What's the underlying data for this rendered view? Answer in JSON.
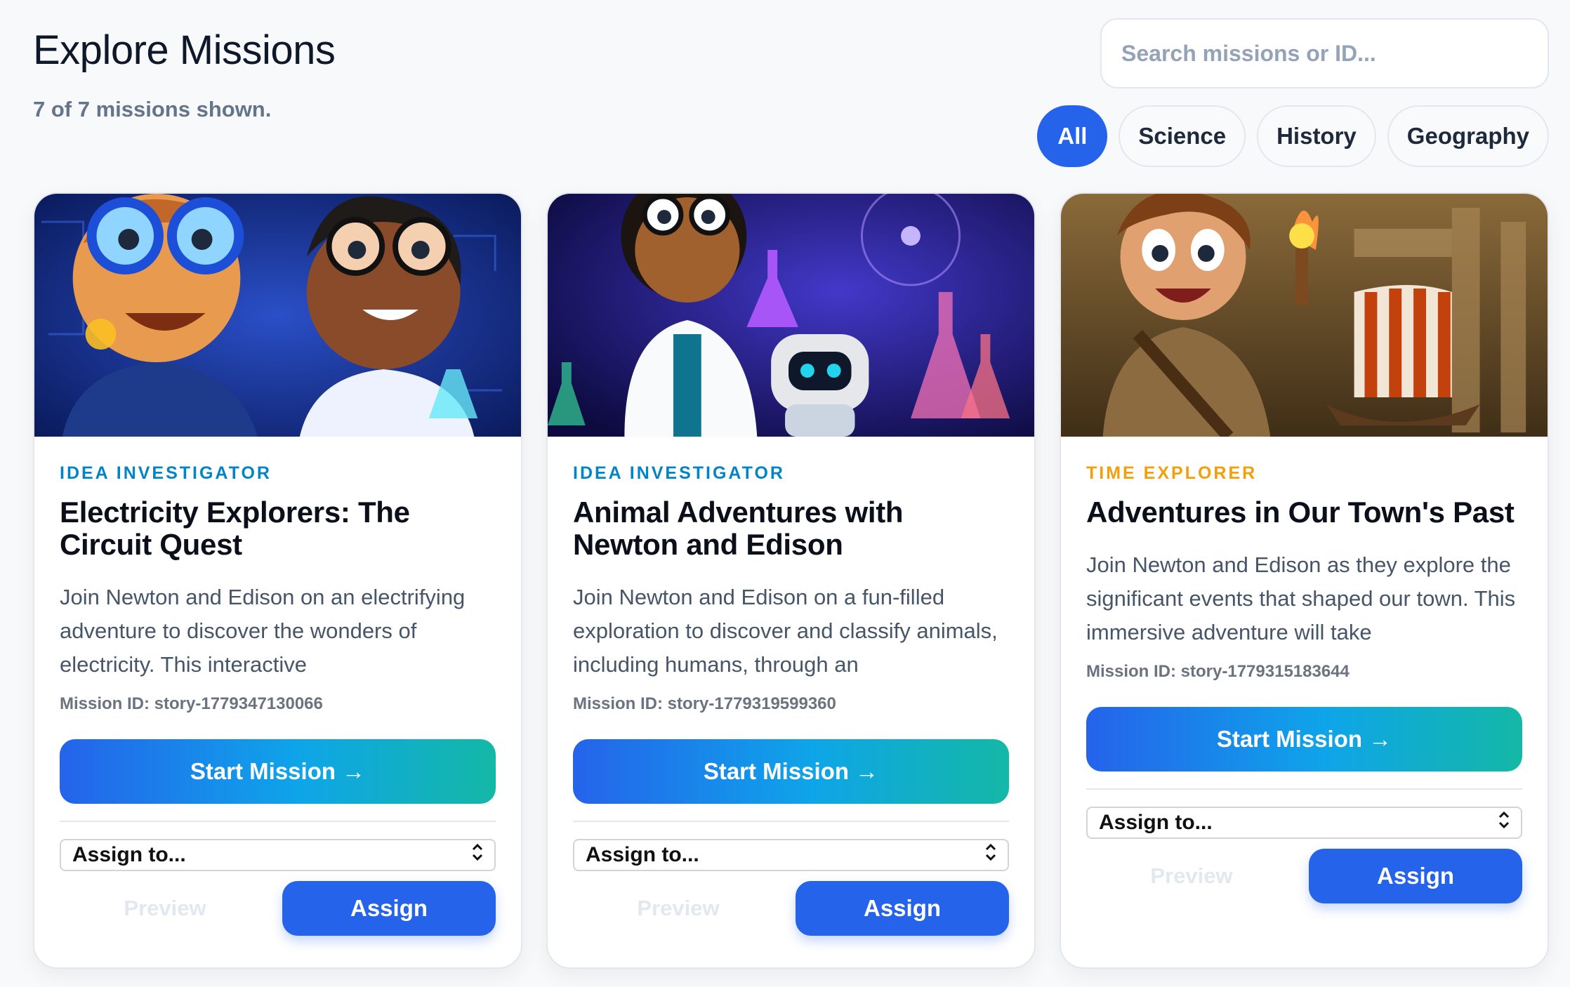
{
  "header": {
    "title": "Explore Missions",
    "count_text": "7 of 7 missions shown."
  },
  "search": {
    "placeholder": "Search missions or ID...",
    "value": ""
  },
  "filters": [
    {
      "label": "All",
      "active": true
    },
    {
      "label": "Science",
      "active": false
    },
    {
      "label": "History",
      "active": false
    },
    {
      "label": "Geography",
      "active": false
    }
  ],
  "colors": {
    "accent": "#2563eb",
    "idea_investigator": "#0284c7",
    "time_explorer": "#f59e0b"
  },
  "cards": [
    {
      "category": "IDEA INVESTIGATOR",
      "category_color": "#0284c7",
      "title": "Electricity Explorers: The Circuit Quest",
      "description": "Join Newton and Edison on an electrifying adventure to discover the wonders of electricity. This interactive",
      "mission_id": "Mission ID: story-1779347130066",
      "start_label": "Start Mission →",
      "assign_select": "Assign to...",
      "preview_label": "Preview",
      "assign_label": "Assign",
      "image": "two-kids-with-glasses-electricity-illustration"
    },
    {
      "category": "IDEA INVESTIGATOR",
      "category_color": "#0284c7",
      "title": "Animal Adventures with Newton and Edison",
      "description": "Join Newton and Edison on a fun-filled exploration to discover and classify animals, including humans, through an",
      "mission_id": "Mission ID: story-1779319599360",
      "start_label": "Start Mission →",
      "assign_select": "Assign to...",
      "preview_label": "Preview",
      "assign_label": "Assign",
      "image": "scientist-girl-and-robot-lab-illustration"
    },
    {
      "category": "TIME EXPLORER",
      "category_color": "#f59e0b",
      "title": "Adventures in Our Town's Past",
      "description": "Join Newton and Edison as they explore the significant events that shaped our town. This immersive adventure will take",
      "mission_id": "Mission ID: story-1779315183644",
      "start_label": "Start Mission →",
      "assign_select": "Assign to...",
      "preview_label": "Preview",
      "assign_label": "Assign",
      "image": "boy-with-torch-and-viking-ship-illustration"
    }
  ]
}
